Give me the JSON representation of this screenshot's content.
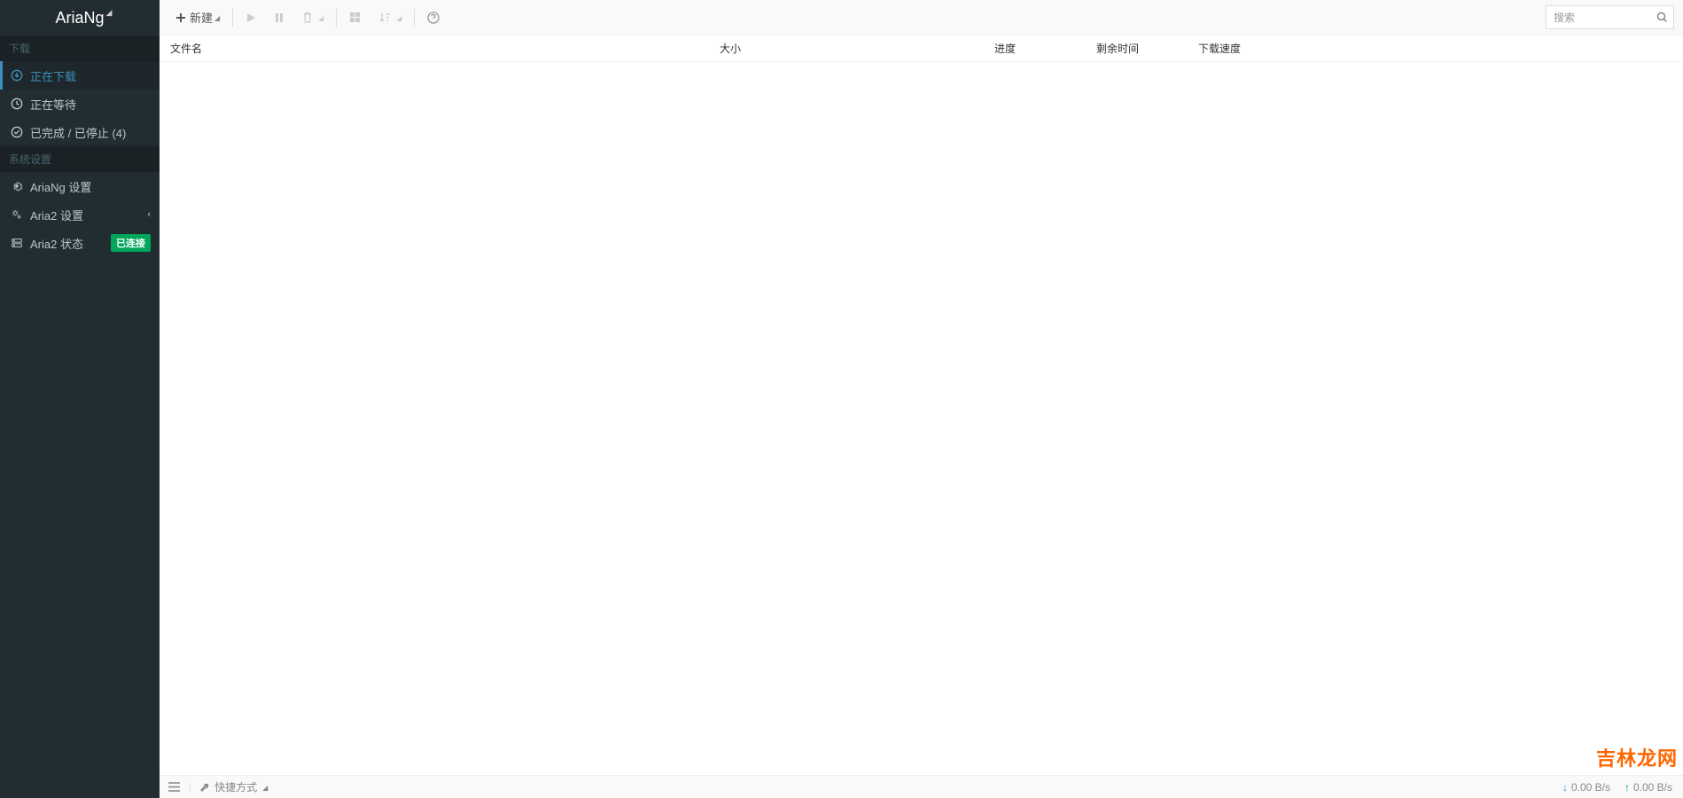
{
  "app": {
    "title": "AriaNg"
  },
  "sidebar": {
    "section_download": "下载",
    "section_settings": "系统设置",
    "items": {
      "downloading": "正在下载",
      "waiting": "正在等待",
      "stopped": "已完成 / 已停止 (4)",
      "ariang_settings": "AriaNg 设置",
      "aria2_settings": "Aria2 设置",
      "aria2_status": "Aria2 状态"
    },
    "connected_badge": "已连接"
  },
  "toolbar": {
    "new": "新建"
  },
  "search": {
    "placeholder": "搜索"
  },
  "table": {
    "headers": {
      "name": "文件名",
      "size": "大小",
      "progress": "进度",
      "remaining": "剩余时间",
      "speed": "下载速度"
    }
  },
  "footer": {
    "shortcut": "快捷方式",
    "download_speed": "0.00 B/s",
    "upload_speed": "0.00 B/s"
  },
  "watermark": "吉林龙网"
}
